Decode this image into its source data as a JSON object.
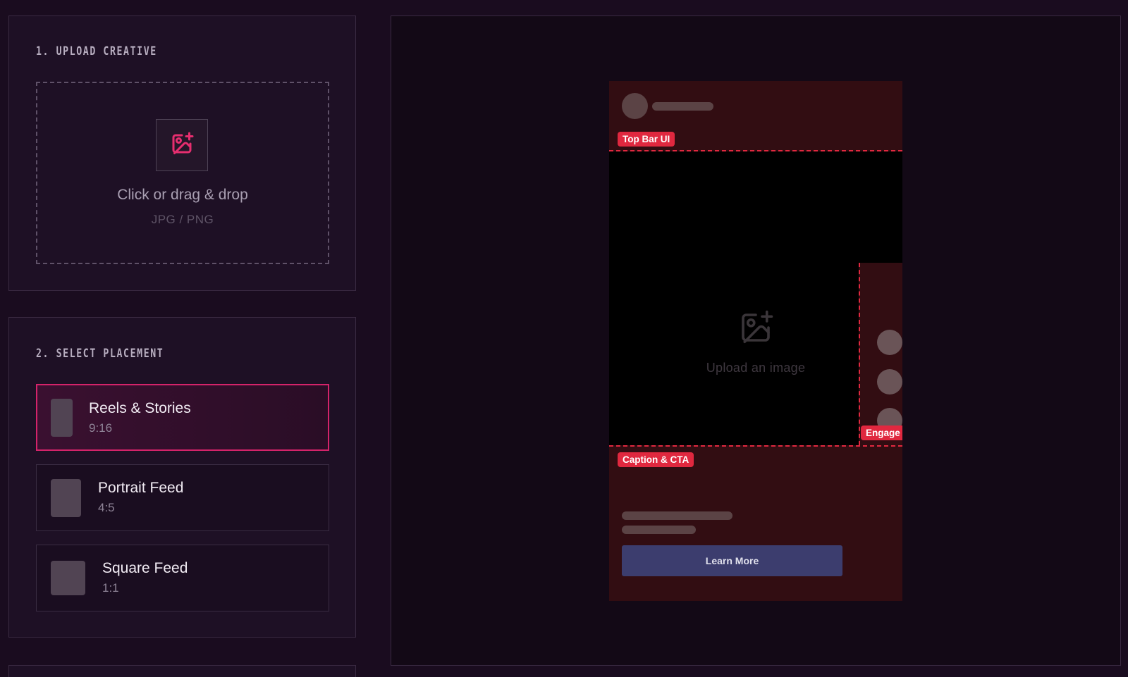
{
  "colors": {
    "background": "#1a0c1f",
    "accent": "#d4236a",
    "zone_overlay": "#320d12",
    "zone_tag": "#e0283f",
    "cta": "#3c3d6e"
  },
  "upload": {
    "title": "1. UPLOAD CREATIVE",
    "icon": "image-plus-icon",
    "prompt": "Click or drag & drop",
    "formats": "JPG / PNG"
  },
  "placement": {
    "title": "2. SELECT PLACEMENT",
    "selected": "Reels & Stories",
    "options": [
      {
        "label": "Reels & Stories",
        "ratio": "9:16"
      },
      {
        "label": "Portrait Feed",
        "ratio": "4:5"
      },
      {
        "label": "Square Feed",
        "ratio": "1:1"
      }
    ]
  },
  "preview": {
    "placeholder_icon": "image-plus-icon",
    "placeholder_text": "Upload an image",
    "zones": {
      "top": "Top Bar UI",
      "right": "Engage",
      "bottom": "Caption & CTA"
    },
    "cta_label": "Learn More"
  }
}
